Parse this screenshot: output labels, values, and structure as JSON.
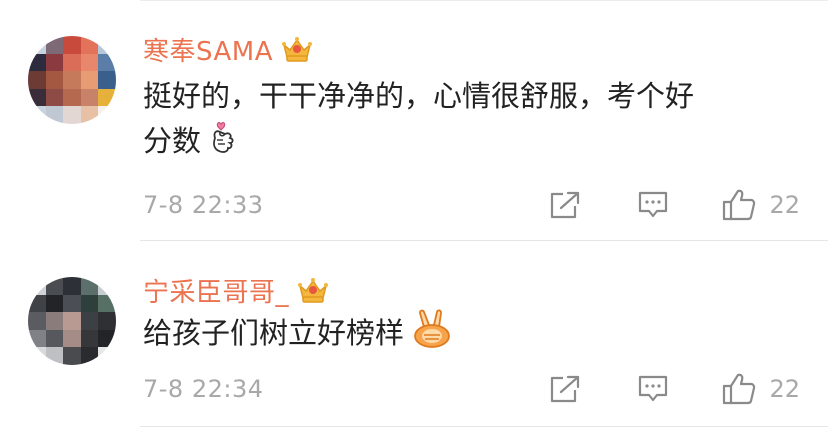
{
  "comments": [
    {
      "username": "寒奉SAMA",
      "text_line1": "挺好的，干干净净的，心情很舒服，考个好",
      "text_line2": "分数",
      "timestamp": "7-8 22:33",
      "likes": "22",
      "badge_icon": "vip-crown-icon",
      "emoji_icon": "finger-heart-emoji-icon"
    },
    {
      "username": "宁采臣哥哥_",
      "text_line1": "给孩子们树立好榜样",
      "timestamp": "7-8 22:34",
      "likes": "22",
      "badge_icon": "vip-crown-icon",
      "emoji_icon": "victory-hand-emoji-icon"
    }
  ],
  "colors": {
    "username": "#eb7350",
    "text": "#222222",
    "meta": "#a8a8a8",
    "icon_stroke": "#8a8a8a",
    "crown_gold": "#f4b73e",
    "crown_red": "#e9573f"
  },
  "icons": {
    "forward": "share-forward-icon",
    "comment": "comment-bubble-icon",
    "like": "thumbs-up-icon"
  }
}
